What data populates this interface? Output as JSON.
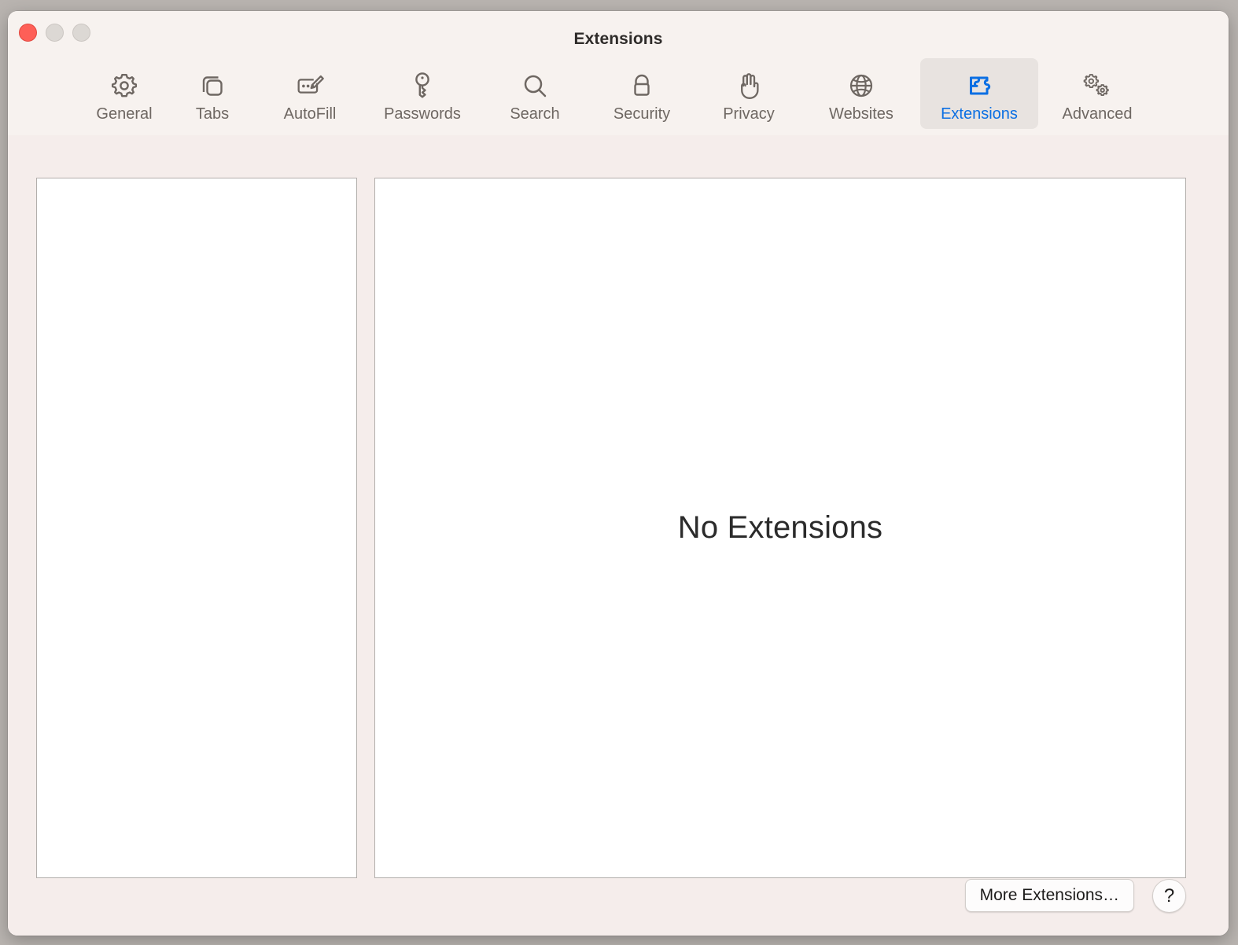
{
  "window": {
    "title": "Extensions",
    "traffic_lights": [
      {
        "name": "close",
        "color": "#fe5f57"
      },
      {
        "name": "minimize",
        "color": "#dcd8d4"
      },
      {
        "name": "maximize",
        "color": "#dcd8d4"
      }
    ],
    "background": "#f5edeb",
    "toolbar_background": "#f7f2ef"
  },
  "toolbar": {
    "selected_tab": "Extensions",
    "accent_color": "#0b6fe3",
    "selected_background": "#e8e3e0",
    "label_color": "#6e6762",
    "tabs": [
      {
        "label": "General",
        "icon": "gear-icon",
        "selected": false
      },
      {
        "label": "Tabs",
        "icon": "tabs-icon",
        "selected": false
      },
      {
        "label": "AutoFill",
        "icon": "autofill-icon",
        "selected": false
      },
      {
        "label": "Passwords",
        "icon": "key-icon",
        "selected": false
      },
      {
        "label": "Search",
        "icon": "search-icon",
        "selected": false
      },
      {
        "label": "Security",
        "icon": "lock-icon",
        "selected": false
      },
      {
        "label": "Privacy",
        "icon": "hand-icon",
        "selected": false
      },
      {
        "label": "Websites",
        "icon": "globe-icon",
        "selected": false
      },
      {
        "label": "Extensions",
        "icon": "puzzle-icon",
        "selected": true
      },
      {
        "label": "Advanced",
        "icon": "double-gear-icon",
        "selected": false
      }
    ]
  },
  "main": {
    "extensions_list": {
      "items": [],
      "empty": true
    },
    "detail_pane": {
      "empty_message": "No Extensions"
    }
  },
  "bottom": {
    "more_extensions_label": "More Extensions…",
    "help_label": "?"
  }
}
